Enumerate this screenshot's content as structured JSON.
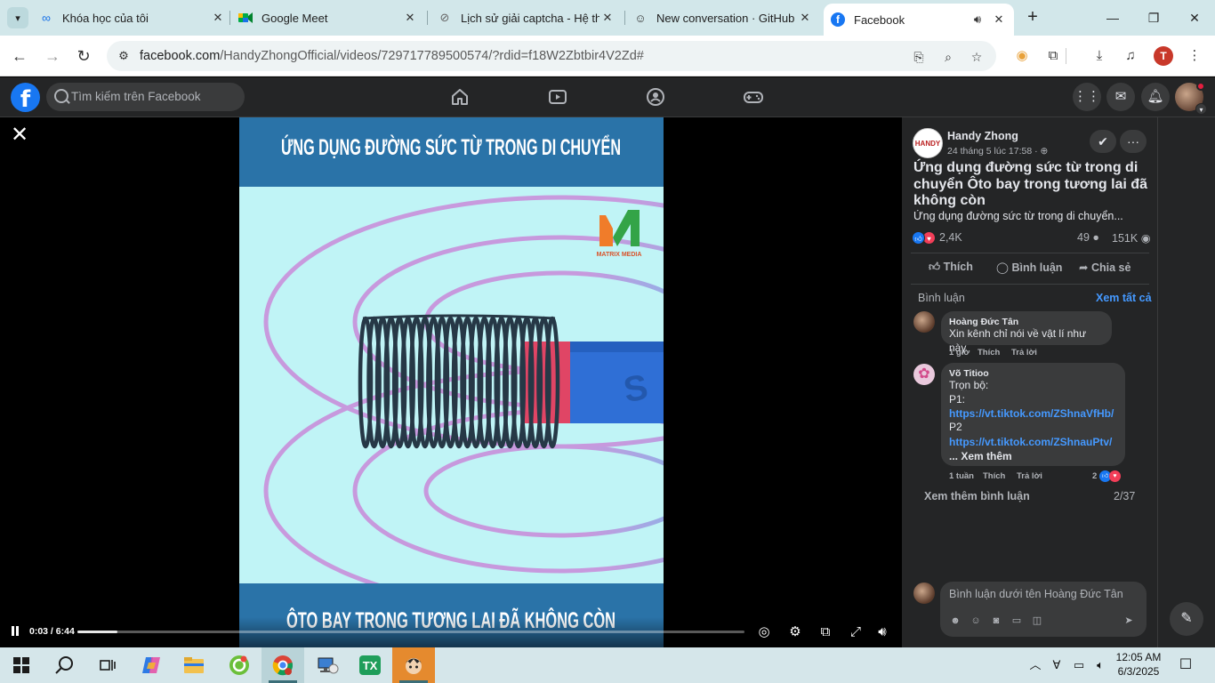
{
  "browser": {
    "tabs": [
      {
        "label": "Khóa học của tôi",
        "icon": "infinity-icon"
      },
      {
        "label": "Google Meet",
        "icon": "google-meet-icon"
      },
      {
        "label": "Lịch sử giải captcha - Hệ thố",
        "icon": "captcha-icon"
      },
      {
        "label": "New conversation · GitHub C",
        "icon": "copilot-icon"
      },
      {
        "label": "Facebook",
        "icon": "facebook-icon",
        "active": true
      }
    ],
    "address": {
      "host": "facebook.com",
      "path": "/HandyZhongOfficial/videos/729717789500574/?rdid=f18W2Zbtbir4V2Zd#"
    },
    "profile_initial": "T"
  },
  "facebook": {
    "search_placeholder": "Tìm kiếm trên Facebook",
    "video": {
      "title_top": "ỨNG DỤNG ĐƯỜNG SỨC TỪ TRONG DI CHUYỂN",
      "title_bottom": "ÔTO BAY TRONG TƯƠNG LAI ĐÃ KHÔNG CÒN",
      "watermark": "MATRIX MEDIA",
      "magnet_letter": "S",
      "time": "0:03 / 6:44",
      "progress": 0.06
    },
    "post": {
      "page_name": "Handy Zhong",
      "date": "24 tháng 5 lúc 17:58 · ",
      "title": "Ứng dụng đường sức từ trong di chuyển Ôto bay trong tương lai đã không còn",
      "description": "Ứng dụng đường sức từ trong di chuyển...",
      "reactions": "2,4K",
      "comments": "49",
      "views": "151K",
      "actions": {
        "like": "Thích",
        "comment": "Bình luận",
        "share": "Chia sẻ"
      },
      "comments_header": "Bình luận",
      "see_all": "Xem tất cả"
    },
    "comments": [
      {
        "name": "Hoàng Đức Tân",
        "text": "Xin kênh chỉ nói về vật lí như này",
        "time": "1 giờ",
        "like": "Thích",
        "reply": "Trả lời"
      },
      {
        "name": "Võ Titioo",
        "lines": [
          "Trọn bộ:",
          "P1:"
        ],
        "link1": "https://vt.tiktok.com/ZShnaVfHb/",
        "line3": "P2",
        "link2": "https://vt.tiktok.com/ZShnauPtv/",
        "more": "... Xem thêm",
        "time": "1 tuần",
        "like": "Thích",
        "reply": "Trả lời",
        "reaction_count": "2"
      }
    ],
    "more_comments": "Xem thêm bình luận",
    "more_comments_count": "2/37",
    "composer_placeholder": "Bình luận dưới tên Hoàng Đức Tân"
  },
  "taskbar": {
    "time": "12:05 AM",
    "date": "6/3/2025"
  },
  "colors": {
    "fb_blue": "#1877f2",
    "panel_bg": "#242526",
    "video_banner": "#2a73a8",
    "video_bg": "#c0f4f6"
  }
}
